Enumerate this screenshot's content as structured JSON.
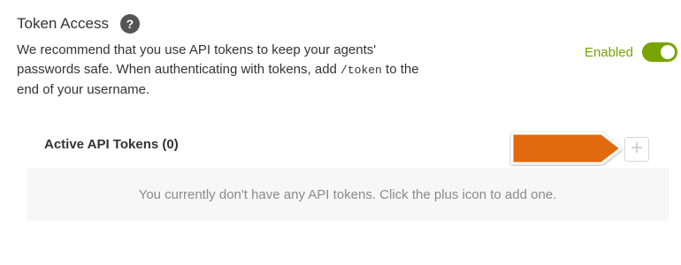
{
  "section": {
    "title": "Token Access",
    "help_icon": "question-icon",
    "help_glyph": "?"
  },
  "description": {
    "part1": "We recommend that you use API tokens to keep your agents' passwords safe. When authenticating with tokens, add ",
    "code": "/token",
    "part2": " to the end of your username."
  },
  "toggle": {
    "label": "Enabled",
    "state": "on",
    "color": "#78a300"
  },
  "tokens": {
    "header": "Active API Tokens (0)",
    "add_icon": "plus-icon",
    "add_glyph": "+",
    "empty_message": "You currently don't have any API tokens. Click the plus icon to add one."
  },
  "annotation": {
    "arrow_color": "#e06a0c"
  }
}
